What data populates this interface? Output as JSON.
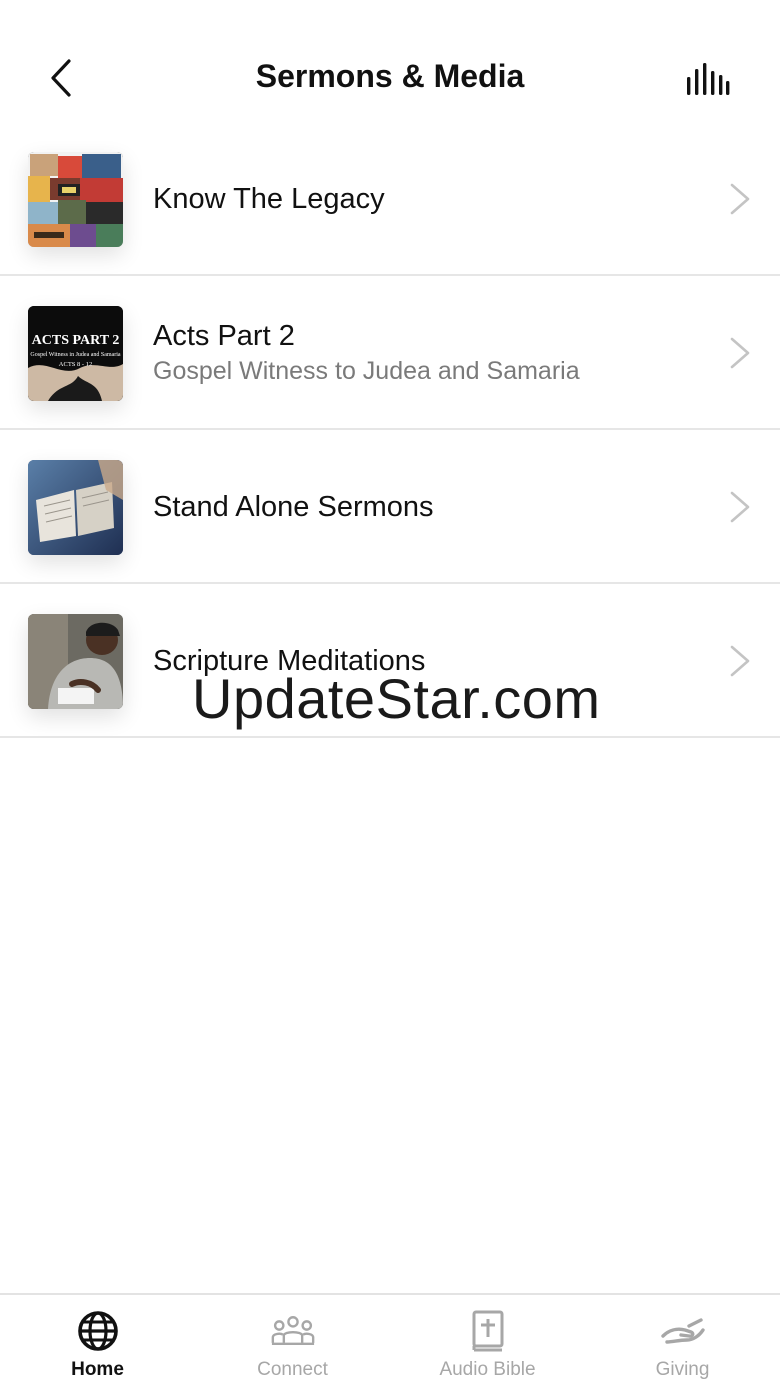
{
  "header": {
    "title": "Sermons & Media"
  },
  "list": {
    "items": [
      {
        "title": "Know The Legacy",
        "subtitle": ""
      },
      {
        "title": "Acts Part 2",
        "subtitle": "Gospel Witness to Judea and Samaria",
        "thumb_text": [
          "ACTS PART 2",
          "Gospel Witness in Judea and Samaria",
          "ACTS 8 - 12"
        ]
      },
      {
        "title": "Stand Alone Sermons",
        "subtitle": ""
      },
      {
        "title": "Scripture Meditations",
        "subtitle": ""
      }
    ]
  },
  "watermark": "UpdateStar.com",
  "tabbar": {
    "tabs": [
      {
        "label": "Home",
        "icon": "globe-icon",
        "active": true
      },
      {
        "label": "Connect",
        "icon": "people-group-icon",
        "active": false
      },
      {
        "label": "Audio Bible",
        "icon": "bible-icon",
        "active": false
      },
      {
        "label": "Giving",
        "icon": "giving-hand-icon",
        "active": false
      }
    ]
  },
  "colors": {
    "text_primary": "#111111",
    "text_secondary": "#7a7a7a",
    "tab_inactive": "#a7a7a7",
    "divider": "#e6e6e6",
    "chevron": "#c4c4c4"
  }
}
